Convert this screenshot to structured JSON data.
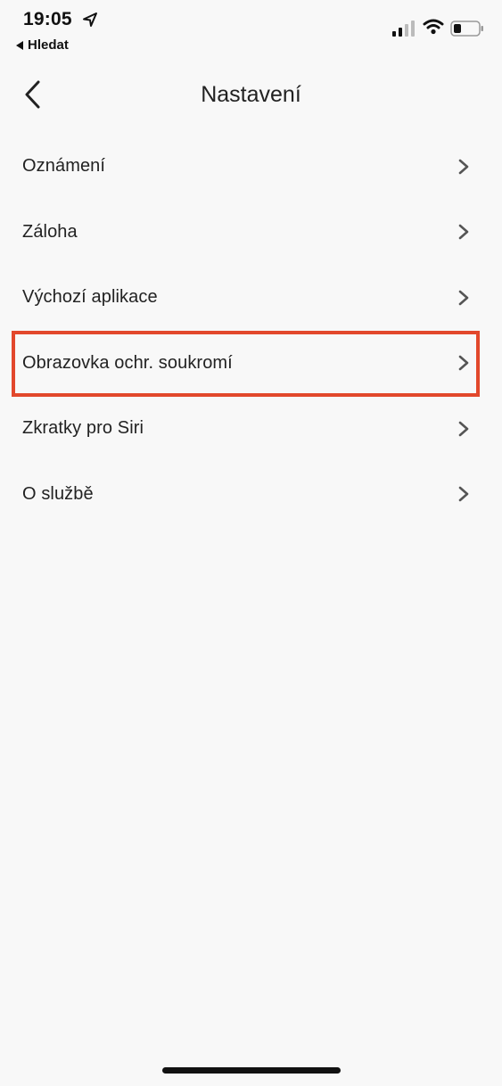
{
  "status_bar": {
    "time": "19:05",
    "back_app_label": "Hledat"
  },
  "nav": {
    "title": "Nastavení"
  },
  "menu": {
    "items": [
      {
        "label": "Oznámení"
      },
      {
        "label": "Záloha"
      },
      {
        "label": "Výchozí aplikace"
      },
      {
        "label": "Obrazovka ochr. soukromí",
        "highlighted": true
      },
      {
        "label": "Zkratky pro Siri"
      },
      {
        "label": "O službě"
      }
    ]
  },
  "colors": {
    "highlight_border": "#e2482c",
    "background": "#f8f8f8",
    "chevron": "#555555"
  }
}
